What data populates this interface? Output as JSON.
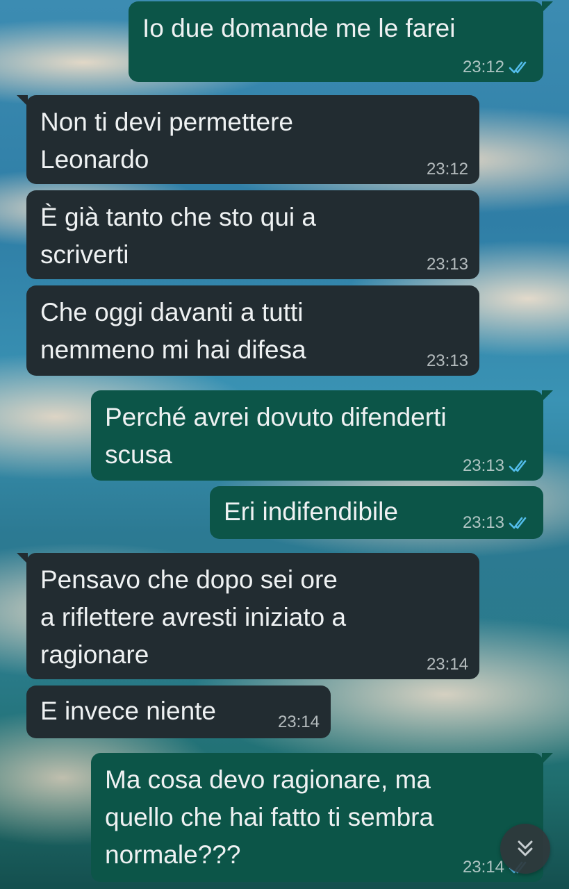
{
  "colors": {
    "incoming_bubble": "#222c31",
    "outgoing_bubble": "#0c5548",
    "read_ticks": "#53bdeb"
  },
  "messages": [
    {
      "direction": "out",
      "text": "Io due domande me le farei",
      "time": "23:12",
      "status": "read"
    },
    {
      "direction": "in",
      "text": "Non ti devi permettere\nLeonardo",
      "time": "23:12"
    },
    {
      "direction": "in",
      "text": "È già tanto che sto qui a\nscriverti",
      "time": "23:13"
    },
    {
      "direction": "in",
      "text": "Che oggi davanti a tutti\nnemmeno mi hai difesa",
      "time": "23:13"
    },
    {
      "direction": "out",
      "text": "Perché avrei dovuto difenderti\nscusa",
      "time": "23:13",
      "status": "read"
    },
    {
      "direction": "out",
      "text": "Eri indifendibile",
      "time": "23:13",
      "status": "read"
    },
    {
      "direction": "in",
      "text": "Pensavo che dopo sei ore\na riflettere avresti iniziato a\nragionare",
      "time": "23:14"
    },
    {
      "direction": "in",
      "text": "E invece niente",
      "time": "23:14"
    },
    {
      "direction": "out",
      "text": "Ma cosa devo ragionare, ma\nquello che hai fatto ti sembra\nnormale???",
      "time": "23:14",
      "status": "read"
    }
  ],
  "scroll_button": {
    "icon": "double-chevron-down-icon"
  }
}
